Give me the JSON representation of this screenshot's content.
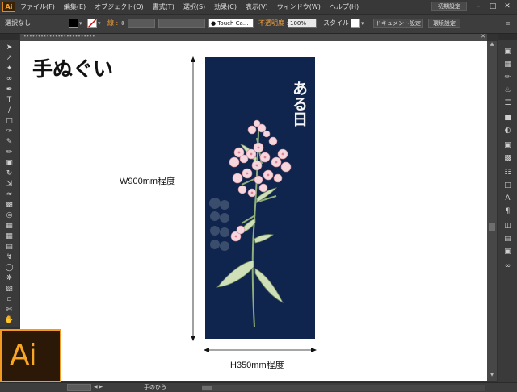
{
  "menubar": {
    "app_icon": "Ai",
    "items": [
      "ファイル(F)",
      "編集(E)",
      "オブジェクト(O)",
      "書式(T)",
      "選択(S)",
      "効果(C)",
      "表示(V)",
      "ウィンドウ(W)",
      "ヘルプ(H)"
    ],
    "workspace": "初期設定"
  },
  "controlbar": {
    "selection_label": "選択なし",
    "stroke_label": "線 :",
    "brush": "Touch Ca...",
    "opacity_label": "不透明度 :",
    "opacity_value": "100%",
    "style_label": "スタイル :",
    "doc_setup": "ドキュメント設定",
    "prefs": "環境設定"
  },
  "statusbar": {
    "status_text": "手のひら"
  },
  "artwork": {
    "title": "手ぬぐい",
    "width_label": "W900mm程度",
    "height_label": "H350mm程度",
    "vertical_text": "ある日",
    "fill_color": "#10254d"
  },
  "logo": {
    "text": "Ai",
    "accent": "#f29a21"
  }
}
